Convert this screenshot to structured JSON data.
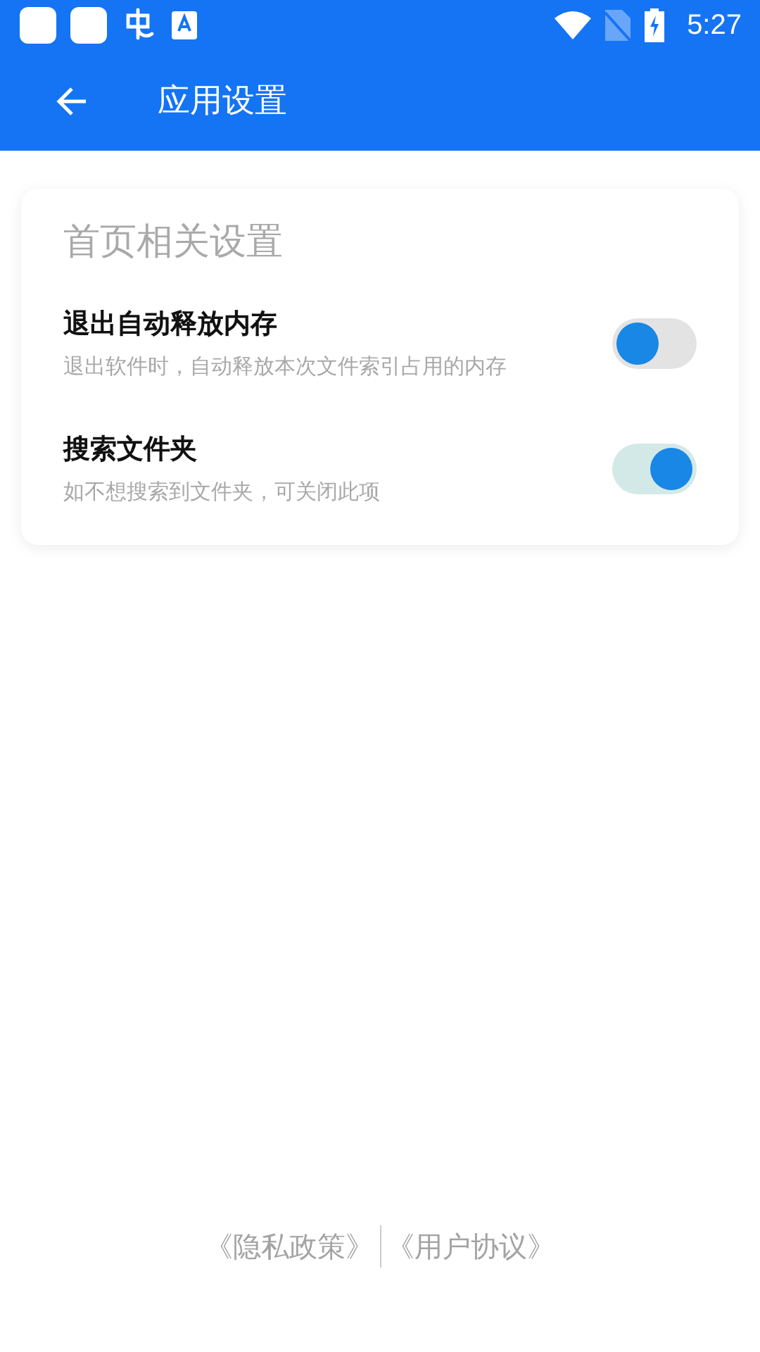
{
  "status_bar": {
    "time": "5:27"
  },
  "app_bar": {
    "title": "应用设置"
  },
  "settings_card": {
    "title": "首页相关设置",
    "items": [
      {
        "title": "退出自动释放内存",
        "description": "退出软件时，自动释放本次文件索引占用的内存",
        "on": false
      },
      {
        "title": "搜索文件夹",
        "description": "如不想搜索到文件夹，可关闭此项",
        "on": true
      }
    ]
  },
  "footer": {
    "links": [
      "《隐私政策》",
      "《用户协议》"
    ]
  }
}
